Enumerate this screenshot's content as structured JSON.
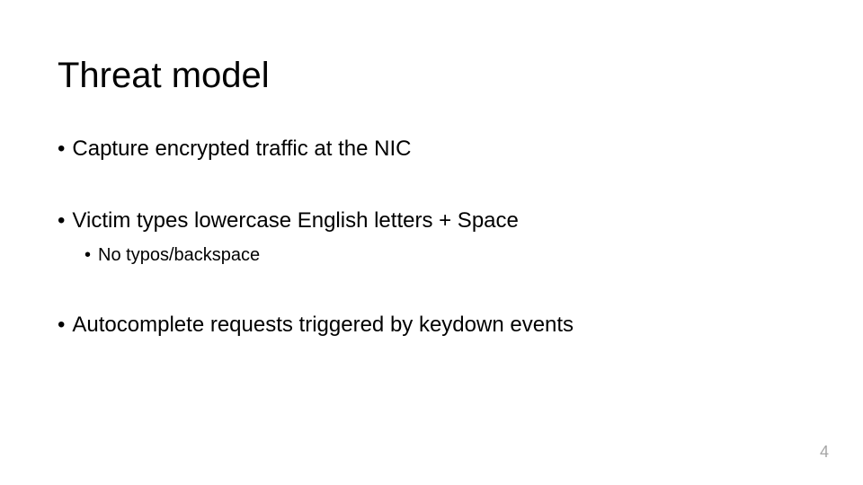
{
  "slide": {
    "title": "Threat model",
    "bullets": [
      {
        "level": 1,
        "text": "Capture encrypted traffic at the NIC"
      },
      {
        "level": 1,
        "text": "Victim types lowercase English letters + Space"
      },
      {
        "level": 2,
        "text": "No typos/backspace"
      },
      {
        "level": 1,
        "text": "Autocomplete requests triggered by keydown events"
      }
    ],
    "page_number": "4"
  }
}
